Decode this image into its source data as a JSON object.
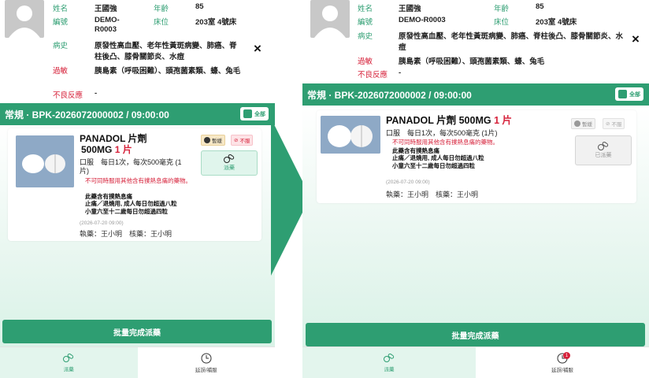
{
  "patient": {
    "name_label": "姓名",
    "name": "王國強",
    "age_label": "年齡",
    "age": "85",
    "id_label": "編號",
    "id": "DEMO-R0003",
    "id_line1": "DEMO-",
    "id_line2": "R0003",
    "bed_label": "床位",
    "bed": "203室 4號床",
    "history_label": "病史",
    "history": "原發性高血壓、老年性黃斑病變、肺癌、脊柱後凸、膝骨關節炎、水痘",
    "allergy_label": "過敏",
    "allergy": "胰島素（呼吸困難）、頭孢菌素類、蠔、兔毛",
    "adverse_label": "不良反應",
    "adverse": "-",
    "close_glyph": "×"
  },
  "order": {
    "header": "常規 · BPK-2026072000002 / 09:00:00",
    "all_label": "全部"
  },
  "medication": {
    "name": "PANADOL 片劑",
    "strength": "500MG",
    "qty": "1 片",
    "dose": "口服　每日1次，每次500毫克 (1片)",
    "warning": "不可同時服用其他含有撲熱息痛的藥物。",
    "note_lines": [
      "此藥含有撲熱息痛",
      "止痛／退燒用, 成人每日勿超過八粒",
      "小童六至十二歲每日勿超過四粒"
    ],
    "timestamp": "(2026-07-20 09:00)",
    "staff": "執藥：王小明　核藥：王小明",
    "hold_label": "暫緩",
    "refuse_label": "不服",
    "dispense_label": "派藥",
    "dispensed_label": "已派藥"
  },
  "actions": {
    "batch_label": "批量完成派藥"
  },
  "nav": {
    "dispense_label": "派藥",
    "delay_label": "延誤/補服",
    "delay_badge": "1"
  },
  "colors": {
    "brand": "#2e9e72",
    "alert": "#d6213a"
  }
}
